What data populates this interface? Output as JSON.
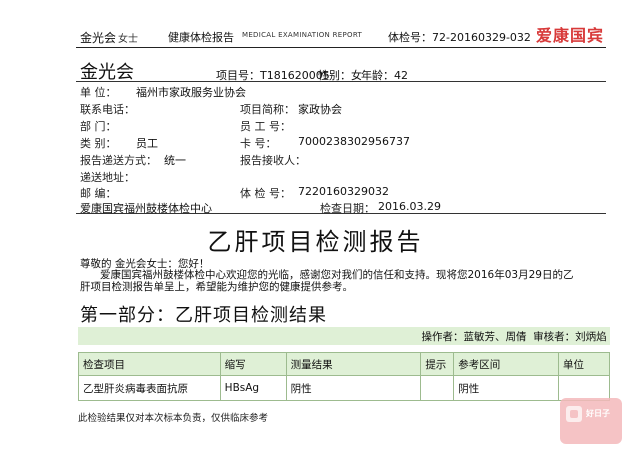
{
  "header": {
    "name": "金光会",
    "gender": "女士",
    "title": "健康体检报告",
    "subtitle": "MEDICAL EXAMINATION REPORT",
    "exam_no": "体检号：72-20160329-032",
    "logo": "爱康国宾"
  },
  "info": {
    "name": "金光会",
    "project_no": "项目号：T181620005",
    "sex": "性别：女",
    "age": "年龄：42",
    "unit_label": "单    位：",
    "unit_value": "福州市家政服务业协会",
    "phone_label": "联系电话：",
    "project_abbr_label": "项目简称：",
    "project_abbr_value": "家政协会",
    "dept_label": "部    门：",
    "staff_no_label": "员  工  号：",
    "category_label": "类    别：",
    "category_value": "员工",
    "card_label": "卡      号：",
    "card_value": "7000238302956737",
    "delivery_label": "报告递送方式：",
    "delivery_value": "统一",
    "receiver_label": "报告接收人：",
    "address_label": "递送地址：",
    "zip_label": "邮    编：",
    "exam_no_label": "体  检  号：",
    "exam_no_value": "7220160329032",
    "center": "爱康国宾福州鼓楼体检中心",
    "date_label": "检查日期：",
    "date_value": "2016.03.29"
  },
  "doc_title": "乙肝项目检测报告",
  "greeting": "尊敬的 金光会女士：您好！",
  "body_text_1": "爱康国宾福州鼓楼体检中心欢迎您的光临，感谢您对我们的信任和支持。现将您2016年03月29日的乙",
  "body_text_2": "肝项目检测报告单呈上，希望能为维护您的健康提供参考。",
  "section_title": "第一部分：乙肝项目检测结果",
  "operator": {
    "operator_label": "操作者：",
    "operator_value": "蓝敏芳、周倩",
    "reviewer_label": "审核者：",
    "reviewer_value": "刘炳焰"
  },
  "table": {
    "headers": [
      "检查项目",
      "缩写",
      "测量结果",
      "提示",
      "参考区间",
      "单位"
    ],
    "rows": [
      [
        "乙型肝炎病毒表面抗原",
        "HBsAg",
        "阴性",
        "",
        "阴性",
        ""
      ]
    ]
  },
  "footnote": "此检验结果仅对本次标本负责，仅供临床参考",
  "watermark_text": "好日子"
}
